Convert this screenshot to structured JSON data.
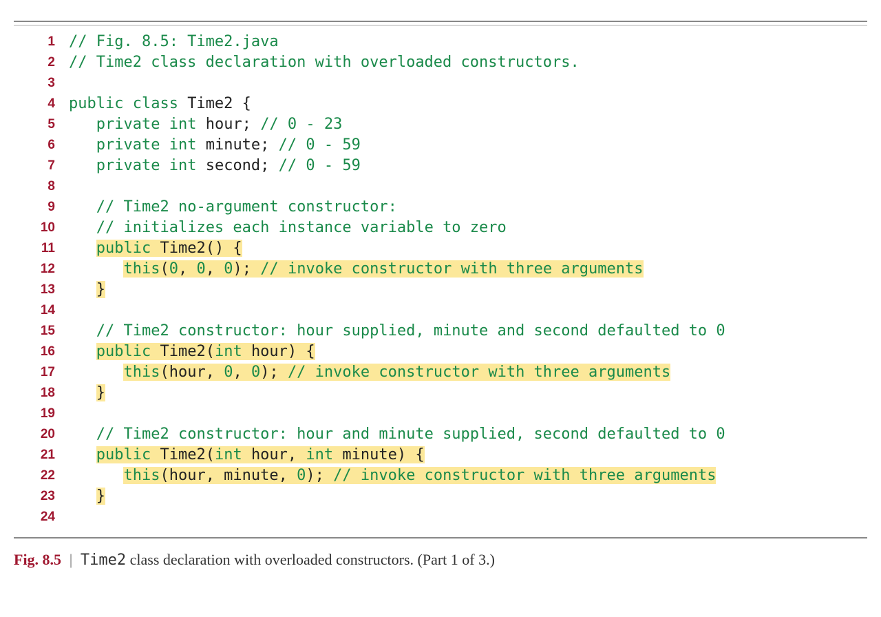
{
  "caption": {
    "label": "Fig. 8.5",
    "text_before": "Time2",
    "text_after": " class declaration with overloaded constructors. (Part 1 of 3.)"
  },
  "code": {
    "lines": [
      {
        "n": "1",
        "segments": [
          {
            "cls": "cm",
            "t": "// Fig. 8.5: Time2.java"
          }
        ]
      },
      {
        "n": "2",
        "segments": [
          {
            "cls": "cm",
            "t": "// Time2 class declaration with overloaded constructors."
          }
        ]
      },
      {
        "n": "3",
        "segments": [
          {
            "cls": "",
            "t": ""
          }
        ]
      },
      {
        "n": "4",
        "segments": [
          {
            "cls": "kw",
            "t": "public class "
          },
          {
            "cls": "id",
            "t": "Time2 {"
          }
        ]
      },
      {
        "n": "5",
        "segments": [
          {
            "cls": "",
            "t": "   "
          },
          {
            "cls": "kw",
            "t": "private int "
          },
          {
            "cls": "id",
            "t": "hour; "
          },
          {
            "cls": "cm",
            "t": "// 0 - 23"
          }
        ]
      },
      {
        "n": "6",
        "segments": [
          {
            "cls": "",
            "t": "   "
          },
          {
            "cls": "kw",
            "t": "private int "
          },
          {
            "cls": "id",
            "t": "minute; "
          },
          {
            "cls": "cm",
            "t": "// 0 - 59"
          }
        ]
      },
      {
        "n": "7",
        "segments": [
          {
            "cls": "",
            "t": "   "
          },
          {
            "cls": "kw",
            "t": "private int "
          },
          {
            "cls": "id",
            "t": "second; "
          },
          {
            "cls": "cm",
            "t": "// 0 - 59"
          }
        ]
      },
      {
        "n": "8",
        "segments": [
          {
            "cls": "",
            "t": ""
          }
        ]
      },
      {
        "n": "9",
        "segments": [
          {
            "cls": "",
            "t": "   "
          },
          {
            "cls": "cm",
            "t": "// Time2 no-argument constructor:"
          }
        ]
      },
      {
        "n": "10",
        "segments": [
          {
            "cls": "",
            "t": "   "
          },
          {
            "cls": "cm",
            "t": "// initializes each instance variable to zero"
          }
        ]
      },
      {
        "n": "11",
        "segments": [
          {
            "cls": "",
            "t": "   "
          },
          {
            "cls": "kw hl",
            "t": "public "
          },
          {
            "cls": "id hl",
            "t": "Time2() {"
          }
        ]
      },
      {
        "n": "12",
        "segments": [
          {
            "cls": "",
            "t": "      "
          },
          {
            "cls": "kw hl",
            "t": "this"
          },
          {
            "cls": "id hl",
            "t": "("
          },
          {
            "cls": "num hl",
            "t": "0"
          },
          {
            "cls": "id hl",
            "t": ", "
          },
          {
            "cls": "num hl",
            "t": "0"
          },
          {
            "cls": "id hl",
            "t": ", "
          },
          {
            "cls": "num hl",
            "t": "0"
          },
          {
            "cls": "id hl",
            "t": "); "
          },
          {
            "cls": "cm hl",
            "t": "// invoke constructor with three arguments"
          }
        ]
      },
      {
        "n": "13",
        "segments": [
          {
            "cls": "",
            "t": "   "
          },
          {
            "cls": "id hl",
            "t": "}"
          }
        ]
      },
      {
        "n": "14",
        "segments": [
          {
            "cls": "",
            "t": ""
          }
        ]
      },
      {
        "n": "15",
        "segments": [
          {
            "cls": "",
            "t": "   "
          },
          {
            "cls": "cm",
            "t": "// Time2 constructor: hour supplied, minute and second defaulted to 0"
          }
        ]
      },
      {
        "n": "16",
        "segments": [
          {
            "cls": "",
            "t": "   "
          },
          {
            "cls": "kw hl",
            "t": "public "
          },
          {
            "cls": "id hl",
            "t": "Time2("
          },
          {
            "cls": "kw hl",
            "t": "int "
          },
          {
            "cls": "id hl",
            "t": "hour) {"
          }
        ]
      },
      {
        "n": "17",
        "segments": [
          {
            "cls": "",
            "t": "      "
          },
          {
            "cls": "kw hl",
            "t": "this"
          },
          {
            "cls": "id hl",
            "t": "(hour, "
          },
          {
            "cls": "num hl",
            "t": "0"
          },
          {
            "cls": "id hl",
            "t": ", "
          },
          {
            "cls": "num hl",
            "t": "0"
          },
          {
            "cls": "id hl",
            "t": "); "
          },
          {
            "cls": "cm hl",
            "t": "// invoke constructor with three arguments"
          }
        ]
      },
      {
        "n": "18",
        "segments": [
          {
            "cls": "",
            "t": "   "
          },
          {
            "cls": "id hl",
            "t": "}"
          }
        ]
      },
      {
        "n": "19",
        "segments": [
          {
            "cls": "",
            "t": ""
          }
        ]
      },
      {
        "n": "20",
        "segments": [
          {
            "cls": "",
            "t": "   "
          },
          {
            "cls": "cm",
            "t": "// Time2 constructor: hour and minute supplied, second defaulted to 0"
          }
        ]
      },
      {
        "n": "21",
        "segments": [
          {
            "cls": "",
            "t": "   "
          },
          {
            "cls": "kw hl",
            "t": "public "
          },
          {
            "cls": "id hl",
            "t": "Time2("
          },
          {
            "cls": "kw hl",
            "t": "int "
          },
          {
            "cls": "id hl",
            "t": "hour, "
          },
          {
            "cls": "kw hl",
            "t": "int "
          },
          {
            "cls": "id hl",
            "t": "minute) {"
          }
        ]
      },
      {
        "n": "22",
        "segments": [
          {
            "cls": "",
            "t": "      "
          },
          {
            "cls": "kw hl",
            "t": "this"
          },
          {
            "cls": "id hl",
            "t": "(hour, minute, "
          },
          {
            "cls": "num hl",
            "t": "0"
          },
          {
            "cls": "id hl",
            "t": "); "
          },
          {
            "cls": "cm hl",
            "t": "// invoke constructor with three arguments"
          }
        ]
      },
      {
        "n": "23",
        "segments": [
          {
            "cls": "",
            "t": "   "
          },
          {
            "cls": "id hl",
            "t": "}"
          }
        ]
      },
      {
        "n": "24",
        "segments": [
          {
            "cls": "",
            "t": ""
          }
        ]
      }
    ]
  }
}
